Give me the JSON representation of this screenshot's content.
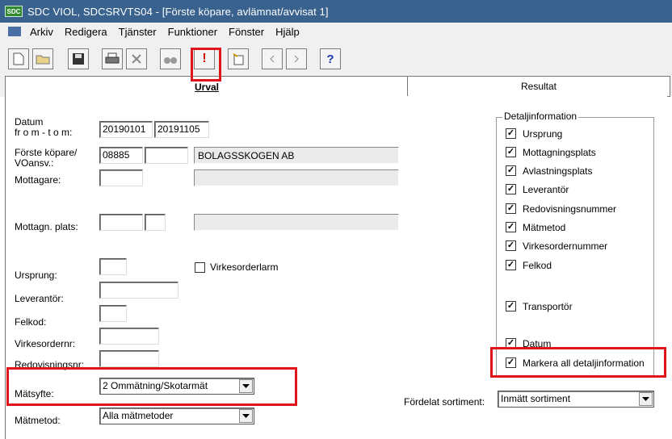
{
  "window": {
    "app_icon": "SDC",
    "title": "SDC VIOL, SDCSRVTS04 - [Förste köpare, avlämnat/avvisat 1]"
  },
  "menu": [
    "Arkiv",
    "Redigera",
    "Tjänster",
    "Funktioner",
    "Fönster",
    "Hjälp"
  ],
  "toolbar": {
    "exclaim": "!",
    "help": "?"
  },
  "tabs": {
    "active": "Urval",
    "inactive": "Resultat"
  },
  "form": {
    "datum_label_1": "Datum",
    "datum_label_2": "fr o m - t o m:",
    "datum_from": "20190101",
    "datum_to": "20191105",
    "kopare_label_1": "Förste köpare/",
    "kopare_label_2": "VOansv.:",
    "kopare_code": "08885",
    "kopare_vo": "",
    "kopare_name": "BOLAGSSKOGEN AB",
    "mottagare_label": "Mottagare:",
    "mottagare_value": "",
    "mottagare_name": "",
    "mottagn_label": "Mottagn. plats:",
    "ursprung_label": "Ursprung:",
    "virkesorderlarm_label": "Virkesorderlarm",
    "leverantor_label": "Leverantör:",
    "felkod_label": "Felkod:",
    "virkesordernr_label": "Virkesordernr:",
    "redovisningsnr_label": "Redovisningsnr:",
    "matsyfte_label": "Mätsyfte:",
    "matsyfte_value": "2 Ommätning/Skotarmät",
    "matmetod_label": "Mätmetod:",
    "matmetod_value": "Alla mätmetoder",
    "fordelat_label": "Fördelat sortiment:",
    "fordelat_value": "Inmätt sortiment"
  },
  "detalj": {
    "title": "Detaljinformation",
    "items": [
      {
        "label": "Ursprung",
        "checked": true
      },
      {
        "label": "Mottagningsplats",
        "checked": true
      },
      {
        "label": "Avlastningsplats",
        "checked": true
      },
      {
        "label": "Leverantör",
        "checked": true
      },
      {
        "label": "Redovisningsnummer",
        "checked": true
      },
      {
        "label": "Mätmetod",
        "checked": true
      },
      {
        "label": "Virkesordernummer",
        "checked": true
      },
      {
        "label": "Felkod",
        "checked": true
      },
      {
        "label": "Transportör",
        "checked": true
      },
      {
        "label": "Datum",
        "checked": true
      },
      {
        "label": "Markera all detaljinformation",
        "checked": true
      }
    ]
  },
  "colors": {
    "titlebar": "#39628e",
    "highlight": "#e0141b"
  }
}
